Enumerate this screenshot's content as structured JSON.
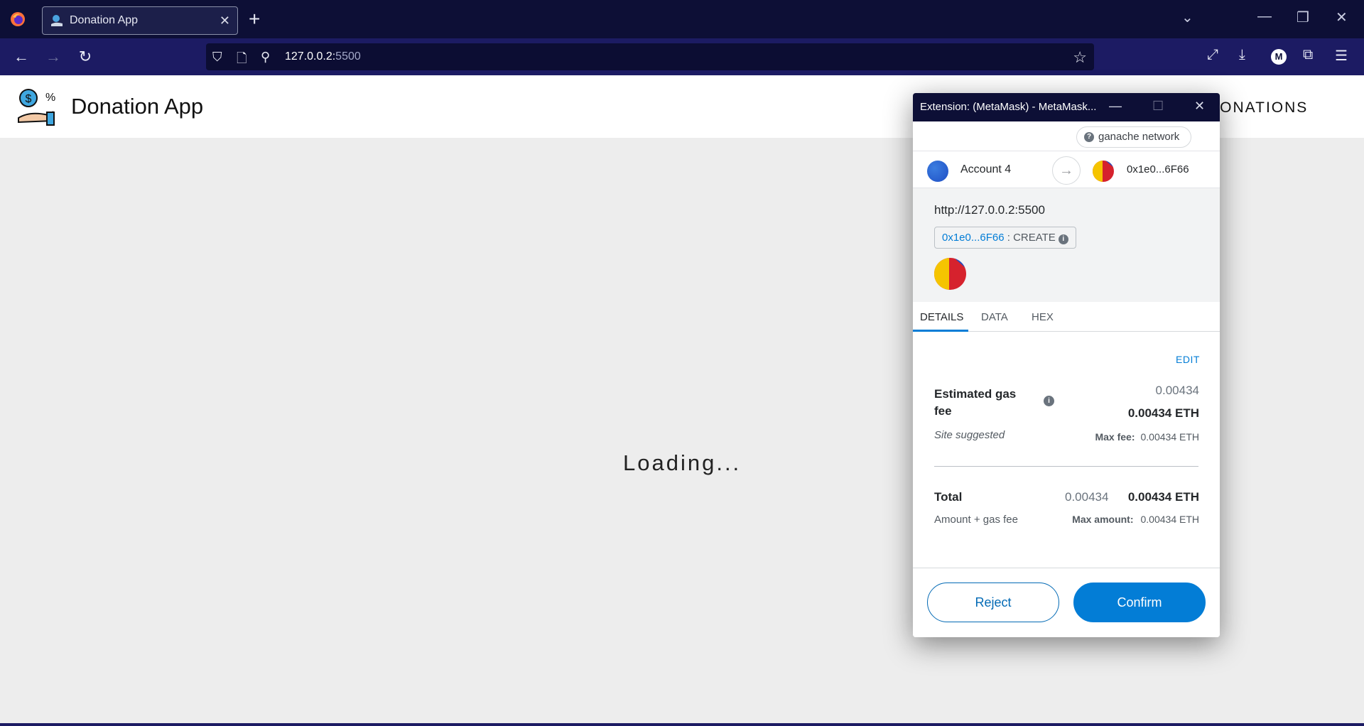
{
  "browser": {
    "tab_title": "Donation App",
    "tab_close": "✕",
    "new_tab": "+",
    "url_host": "127.0.0.2:",
    "url_port": "5500"
  },
  "page": {
    "app_title": "Donation App",
    "nav_donations": "DONATIONS",
    "loading_text": "Loading..."
  },
  "metamask": {
    "window_title": "Extension: (MetaMask) - MetaMask...",
    "network": "ganache network",
    "from_account": "Account 4",
    "to_address": "0x1e0...6F66",
    "origin": "http://127.0.0.2:5500",
    "method_address": "0x1e0...6F66",
    "method_name": " : CREATE",
    "tabs": [
      "DETAILS",
      "DATA",
      "HEX"
    ],
    "edit_label": "EDIT",
    "gas_label": "Estimated gas fee",
    "gas_value": "0.00434",
    "gas_value_eth": "0.00434 ETH",
    "site_suggested": "Site suggested",
    "max_fee_label": "Max fee:",
    "max_fee_value": "0.00434 ETH",
    "total_label": "Total",
    "total_value": "0.00434",
    "total_value_eth": "0.00434 ETH",
    "amount_gas_label": "Amount + gas fee",
    "max_amount_label": "Max amount:",
    "max_amount_value": "0.00434 ETH",
    "reject_label": "Reject",
    "confirm_label": "Confirm"
  },
  "colors": {
    "browser_dark": "#0d0f36",
    "browser_nav": "#1c1b63",
    "metamask_blue": "#037dd6"
  }
}
